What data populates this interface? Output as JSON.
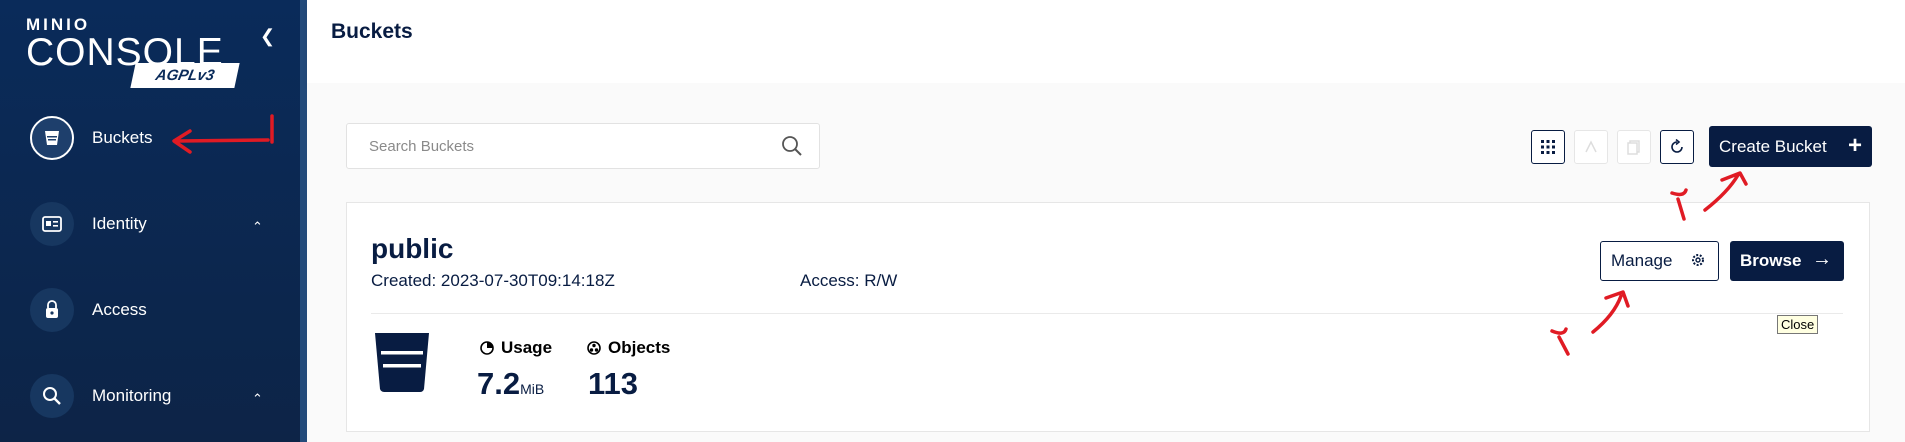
{
  "sidebar": {
    "logo_top": "MINIO",
    "logo_main": "CONSOLE",
    "logo_badge": "AGPLv3",
    "items": [
      {
        "label": "Buckets",
        "icon": "bucket-icon"
      },
      {
        "label": "Identity",
        "icon": "id-card-icon"
      },
      {
        "label": "Access",
        "icon": "lock-icon"
      },
      {
        "label": "Monitoring",
        "icon": "magnifier-icon"
      }
    ]
  },
  "header": {
    "title": "Buckets"
  },
  "search": {
    "placeholder": "Search Buckets"
  },
  "toolbar": {
    "create_label": "Create Bucket"
  },
  "bucket": {
    "name": "public",
    "created": "Created: 2023-07-30T09:14:18Z",
    "access": "Access: R/W",
    "manage_label": "Manage",
    "browse_label": "Browse",
    "usage_label": "Usage",
    "usage_value": "7.2",
    "usage_unit": "MiB",
    "objects_label": "Objects",
    "objects_value": "113"
  },
  "tooltip": "Close",
  "colors": {
    "navy": "#081c42",
    "sidebar": "#0a2b5a",
    "annotation": "#e01b24"
  }
}
